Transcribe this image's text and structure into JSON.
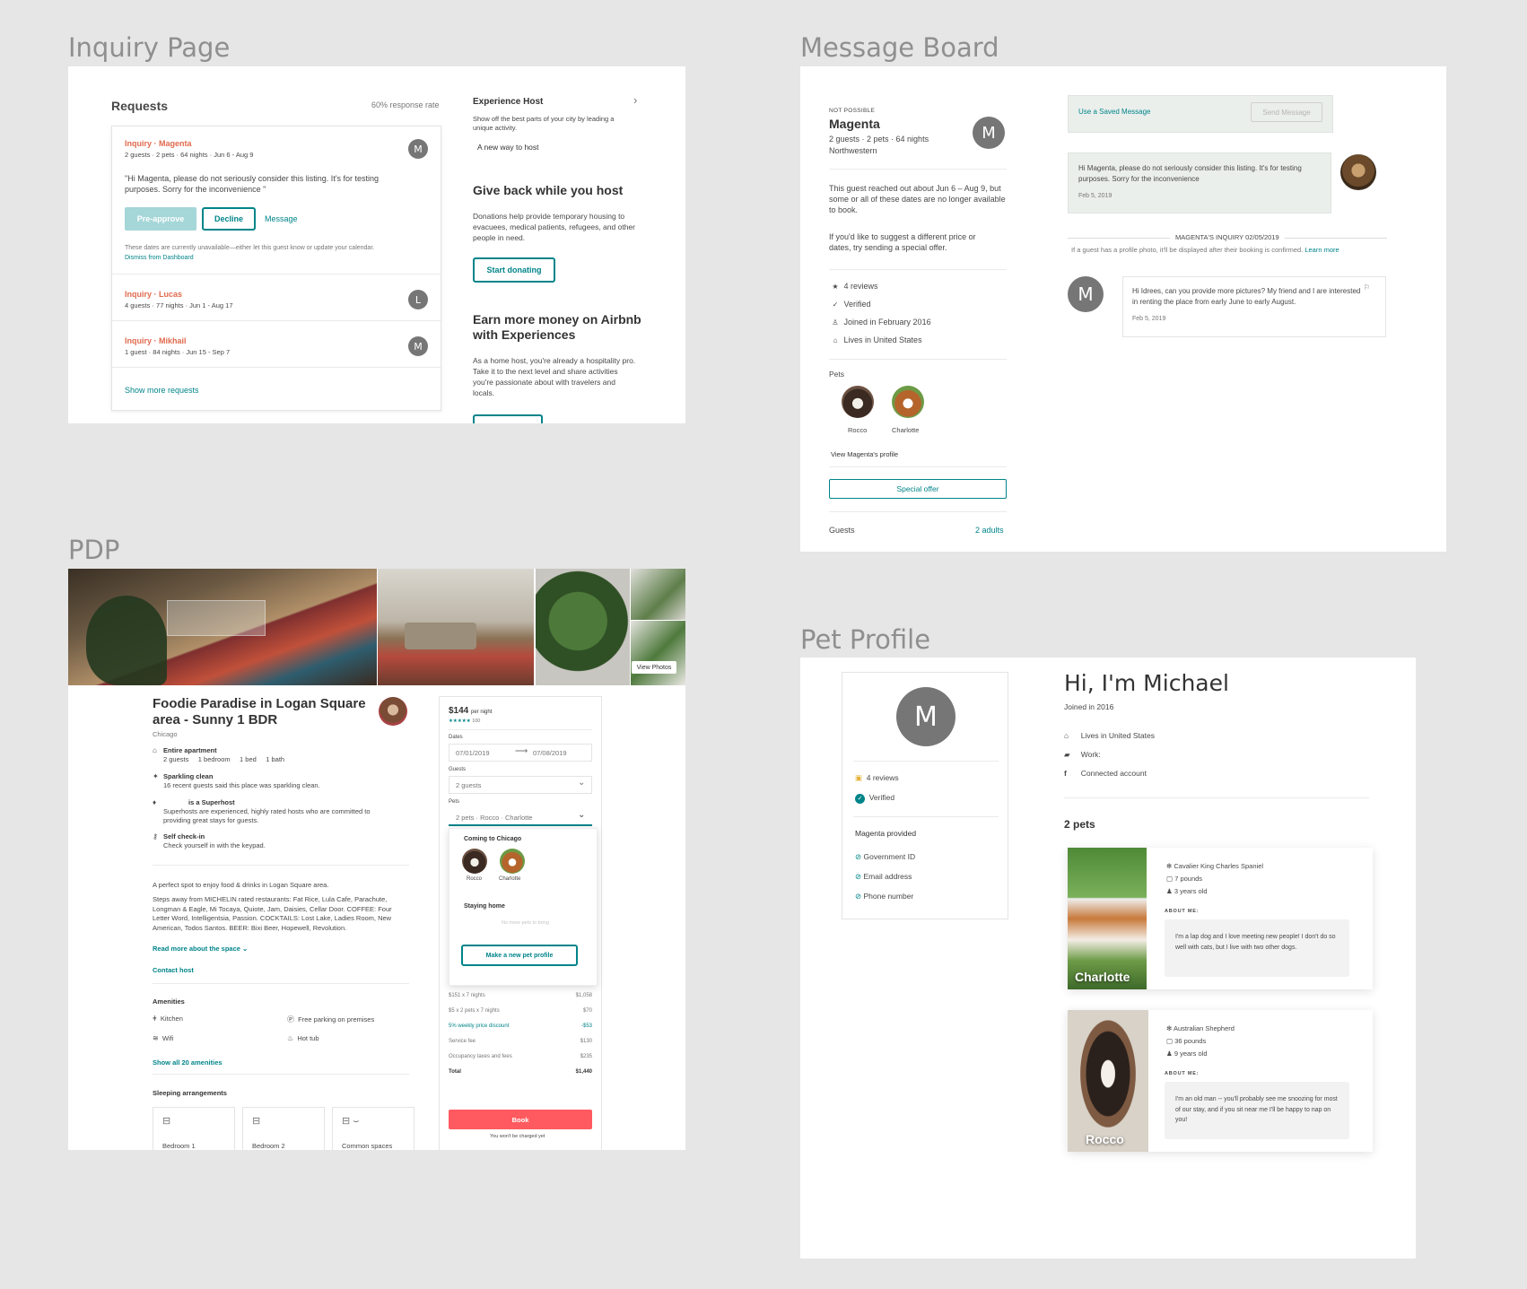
{
  "frames": {
    "inquiry": "Inquiry Page",
    "message": "Message Board",
    "pdp": "PDP",
    "pet": "Pet Profile"
  },
  "inquiry": {
    "title": "Requests",
    "response_rate": "60% response rate",
    "first": {
      "name": "Inquiry · Magenta",
      "meta": "2 guests · 2 pets · 64 nights · Jun 6 - Aug 9",
      "avatar": "M",
      "message": "\"Hi Magenta, please do not seriously consider this listing. It's for testing purposes. Sorry for the inconvenience \"",
      "preapprove": "Pre-approve",
      "decline": "Decline",
      "message_link": "Message",
      "note": "These dates are currently unavailable—either let this guest know or update your calendar.",
      "dismiss": "Dismiss from Dashboard"
    },
    "others": [
      {
        "name": "Inquiry · Lucas",
        "meta": "4 guests · 77 nights · Jun 1 - Aug 17",
        "avatar": "L"
      },
      {
        "name": "Inquiry · Mikhail",
        "meta": "1 guest · 84 nights · Jun 15 - Sep 7",
        "avatar": "M"
      }
    ],
    "show_more": "Show more requests",
    "side": {
      "exp_title": "Experience Host",
      "exp_desc": "Show off the best parts of your city by leading a unique activity.",
      "exp_link": "A new way to host",
      "give_title": "Give back while you host",
      "give_desc": "Donations help provide temporary housing to evacuees, medical patients, refugees, and other people in need.",
      "give_btn": "Start donating",
      "earn_title": "Earn more money on Airbnb with Experiences",
      "earn_desc": "As a home host, you're already a hospitality pro. Take it to the next level and share activities you're passionate about with travelers and locals."
    }
  },
  "message": {
    "status": "NOT POSSIBLE",
    "name": "Magenta",
    "meta": "2 guests · 2 pets · 64 nights",
    "school": "Northwestern",
    "avatar": "M",
    "reach": "This guest reached out about Jun 6 – Aug 9, but some or all of these dates are no longer available to book.",
    "suggest": "If you'd like to suggest a different price or dates, try sending a special offer.",
    "stats": [
      {
        "icon": "star-icon",
        "glyph": "★",
        "text": "4 reviews"
      },
      {
        "icon": "verified-icon",
        "glyph": "✓",
        "text": "Verified"
      },
      {
        "icon": "person-icon",
        "glyph": "♙",
        "text": "Joined in February 2016"
      },
      {
        "icon": "home-icon",
        "glyph": "⌂",
        "text": "Lives in United States"
      }
    ],
    "pets_label": "Pets",
    "pets": [
      "Rocco",
      "Charlotte"
    ],
    "view_profile": "View Magenta's profile",
    "special_offer": "Special offer",
    "guests_label": "Guests",
    "guests_value": "2 adults",
    "saved_msg": "Use a Saved Message",
    "send_msg": "Send Message",
    "host_msg": "Hi Magenta, please do not seriously consider this listing. It's for testing purposes. Sorry for the inconvenience",
    "host_date": "Feb 5, 2019",
    "inquiry_label": "MAGENTA'S INQUIRY 02/05/2019",
    "photo_note": "If a guest has a profile photo, it'll be displayed after their booking is confirmed.",
    "learn_more": "Learn more",
    "guest_msg": "Hi Idrees, can you provide more pictures? My friend and I are interested in renting the place from early June to early August.",
    "guest_date": "Feb 5, 2019"
  },
  "pdp": {
    "view_photos": "View Photos",
    "title": "Foodie Paradise in Logan Square area - Sunny 1 BDR",
    "city": "Chicago",
    "highlights": [
      {
        "icon": "home-icon",
        "glyph": "⌂",
        "title": "Entire apartment",
        "desc": "2 guests     1 bedroom     1 bed     1 bath"
      },
      {
        "icon": "sparkle-icon",
        "glyph": "✦",
        "title": "Sparkling clean",
        "desc": "16 recent guests said this place was sparkling clean."
      },
      {
        "icon": "medal-icon",
        "glyph": "♦",
        "title": "is a Superhost",
        "desc": "Superhosts are experienced, highly rated hosts who are committed to providing great stays for guests."
      },
      {
        "icon": "key-icon",
        "glyph": "⚷",
        "title": "Self check-in",
        "desc": "Check yourself in with the keypad."
      }
    ],
    "desc1": "A perfect spot to enjoy food & drinks in Logan Square area.",
    "desc2": "Steps away from MICHELIN rated restaurants: Fat Rice, Lula Cafe, Parachute, Longman & Eagle, Mi Tocaya, Quiote, Jam, Daisies, Cellar Door. COFFEE: Four Letter Word, Intelligentsia, Passion. COCKTAILS: Lost Lake, Ladies Room, New American, Todos Santos. BEER: Bixi Beer, Hopewell, Revolution.",
    "read_more": "Read more about the space",
    "contact": "Contact host",
    "amenities_title": "Amenities",
    "amenities": [
      {
        "icon": "utensils-icon",
        "glyph": "🍴",
        "text": "Kitchen"
      },
      {
        "icon": "parking-icon",
        "glyph": "Ⓟ",
        "text": "Free parking on premises"
      },
      {
        "icon": "wifi-icon",
        "glyph": "≋",
        "text": "Wifi"
      },
      {
        "icon": "hottub-icon",
        "glyph": "♨",
        "text": "Hot tub"
      }
    ],
    "show_amenities": "Show all 20 amenities",
    "sleeping_title": "Sleeping arrangements",
    "rooms": [
      "Bedroom 1",
      "Bedroom 2",
      "Common spaces"
    ],
    "booking": {
      "price": "$144",
      "per_night": "per night",
      "stars": "★★★★★",
      "review_count": "100",
      "dates_label": "Dates",
      "checkin": "07/01/2019",
      "checkout": "07/08/2019",
      "guests_label": "Guests",
      "guests_value": "2 guests",
      "pets_label": "Pets",
      "pets_value": "2 pets · Rocco · Charlotte",
      "coming": "Coming to Chicago",
      "pets": [
        "Rocco",
        "Charlotte"
      ],
      "staying": "Staying home",
      "no_pets": "No more pets to bring",
      "new_pet": "Make a new pet profile",
      "lines": [
        {
          "label": "$151 x 7 nights",
          "value": "$1,058"
        },
        {
          "label": "$5 x 2 pets x 7 nights",
          "value": "$70"
        },
        {
          "label": "5% weekly price discount",
          "value": "-$53"
        },
        {
          "label": "Service fee",
          "value": "$130"
        },
        {
          "label": "Occupancy taxes and fees",
          "value": "$235"
        }
      ],
      "total_label": "Total",
      "total_value": "$1,440",
      "book": "Book",
      "charged": "You won't be charged yet"
    }
  },
  "pet": {
    "avatar": "M",
    "reviews": "4 reviews",
    "verified": "Verified",
    "provided_title": "Magenta provided",
    "provided": [
      "Government ID",
      "Email address",
      "Phone number"
    ],
    "greeting": "Hi, I'm Michael",
    "joined": "Joined in 2016",
    "info": [
      {
        "icon": "home-icon",
        "glyph": "⌂",
        "text": "Lives in United States"
      },
      {
        "icon": "briefcase-icon",
        "glyph": "▰",
        "text": "Work:"
      },
      {
        "icon": "facebook-icon",
        "glyph": "f",
        "text": "Connected account"
      }
    ],
    "pets_count": "2 pets",
    "cards": [
      {
        "name": "Charlotte",
        "breed": "Cavalier King Charles Spaniel",
        "weight": "7 pounds",
        "age": "3 years old",
        "about_label": "ABOUT ME:",
        "about": "I'm a lap dog and I love meeting new people! I don't do so well with cats, but I live with two other dogs."
      },
      {
        "name": "Rocco",
        "breed": "Australian Shepherd",
        "weight": "36 pounds",
        "age": "9 years old",
        "about_label": "ABOUT ME:",
        "about": "I'm an old man -- you'll probably see me snoozing for most of our stay, and if you sit near me I'll be happy to nap on you!"
      }
    ]
  },
  "colors": {
    "teal": "#008489",
    "coral": "#e06a4e",
    "book": "#ff5a5f",
    "grey_avatar": "#767676"
  }
}
